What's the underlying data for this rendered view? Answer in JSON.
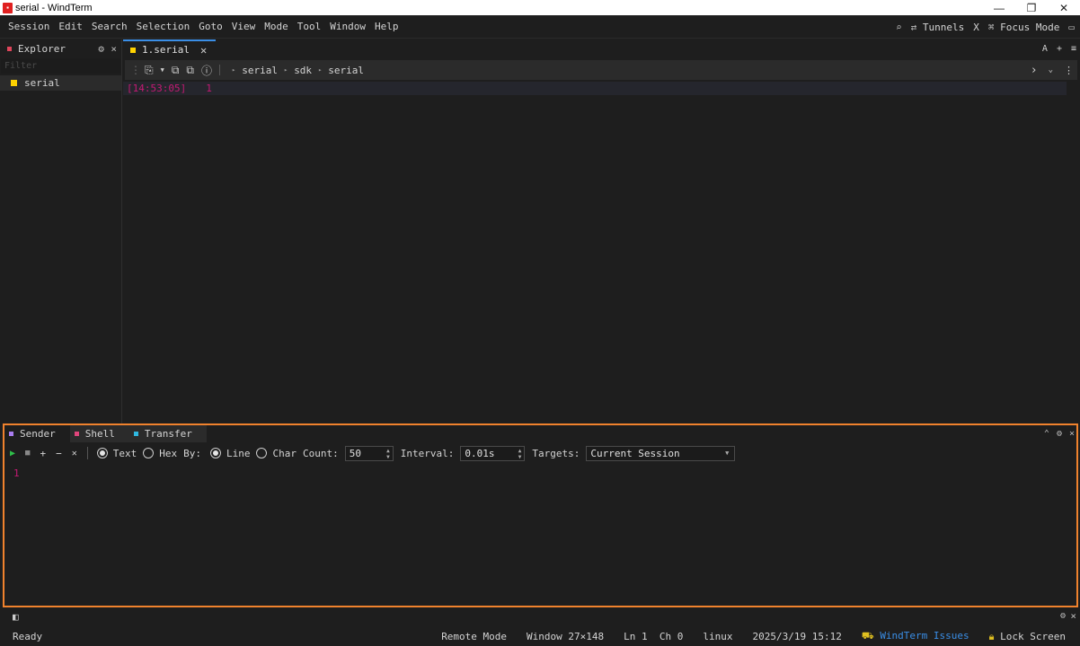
{
  "window": {
    "title": "serial - WindTerm",
    "minimize_glyph": "—",
    "restore_glyph": "❐",
    "close_glyph": "✕"
  },
  "menu": {
    "items": [
      "Session",
      "Edit",
      "Search",
      "Selection",
      "Goto",
      "View",
      "Mode",
      "Tool",
      "Window",
      "Help"
    ],
    "right": {
      "search_icon": "search-icon",
      "tunnels_label": "Tunnels",
      "x_label": "X",
      "focus_mode_label": "Focus Mode"
    }
  },
  "explorer": {
    "title": "Explorer",
    "dot_color": "#e0455b",
    "filter_placeholder": "Filter",
    "items": [
      {
        "label": "serial",
        "color": "#ffd200"
      }
    ]
  },
  "editor": {
    "tab_label": "1.serial",
    "tab_dot_color": "#ffd200",
    "tabs_right": {
      "a_label": "A",
      "plus_label": "+",
      "menu_label": "≡"
    },
    "breadcrumb": [
      "serial",
      "sdk",
      "serial"
    ],
    "terminal_lines": [
      {
        "timestamp": "[14:53:05]",
        "value": "1"
      }
    ]
  },
  "sender_panel": {
    "tabs": [
      {
        "label": "Sender",
        "dot_color": "#a97df0"
      },
      {
        "label": "Shell",
        "dot_color": "#e0457b"
      },
      {
        "label": "Transfer",
        "dot_color": "#2fb8e0"
      }
    ],
    "mode_text_label": "Text",
    "mode_hex_label": "Hex",
    "by_label": "By:",
    "by_line_label": "Line",
    "by_char_label": "Char",
    "count_label": "Count:",
    "count_value": "50",
    "interval_label": "Interval:",
    "interval_value": "0.01s",
    "targets_label": "Targets:",
    "targets_value": "Current Session",
    "content": "1"
  },
  "status": {
    "left": "Ready",
    "remote_mode": "Remote Mode",
    "window_size": "Window 27×148",
    "position": "Ln 1  Ch 0",
    "os": "linux",
    "datetime": "2025/3/19 15:12",
    "issues_link": "WindTerm Issues",
    "lock_screen": "Lock Screen"
  }
}
